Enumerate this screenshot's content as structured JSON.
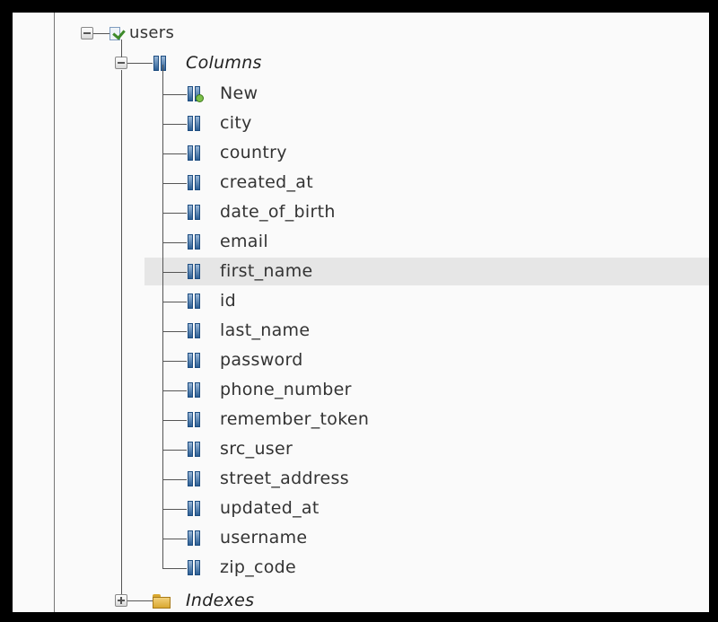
{
  "tree": {
    "table": {
      "name": "users",
      "expanded": true
    },
    "columns_folder": {
      "label": "Columns",
      "expanded": true
    },
    "new_column_label": "New",
    "columns": [
      "city",
      "country",
      "created_at",
      "date_of_birth",
      "email",
      "first_name",
      "id",
      "last_name",
      "password",
      "phone_number",
      "remember_token",
      "src_user",
      "street_address",
      "updated_at",
      "username",
      "zip_code"
    ],
    "selected_column": "first_name",
    "indexes_folder": {
      "label": "Indexes",
      "expanded": false
    }
  },
  "icons": {
    "table": "table-check-icon",
    "column": "column-icon",
    "new_column": "add-column-icon",
    "folder": "folder-icon"
  },
  "colors": {
    "selection": "#e6e6e6",
    "column_icon": "#2d5f95",
    "text": "#333333"
  }
}
